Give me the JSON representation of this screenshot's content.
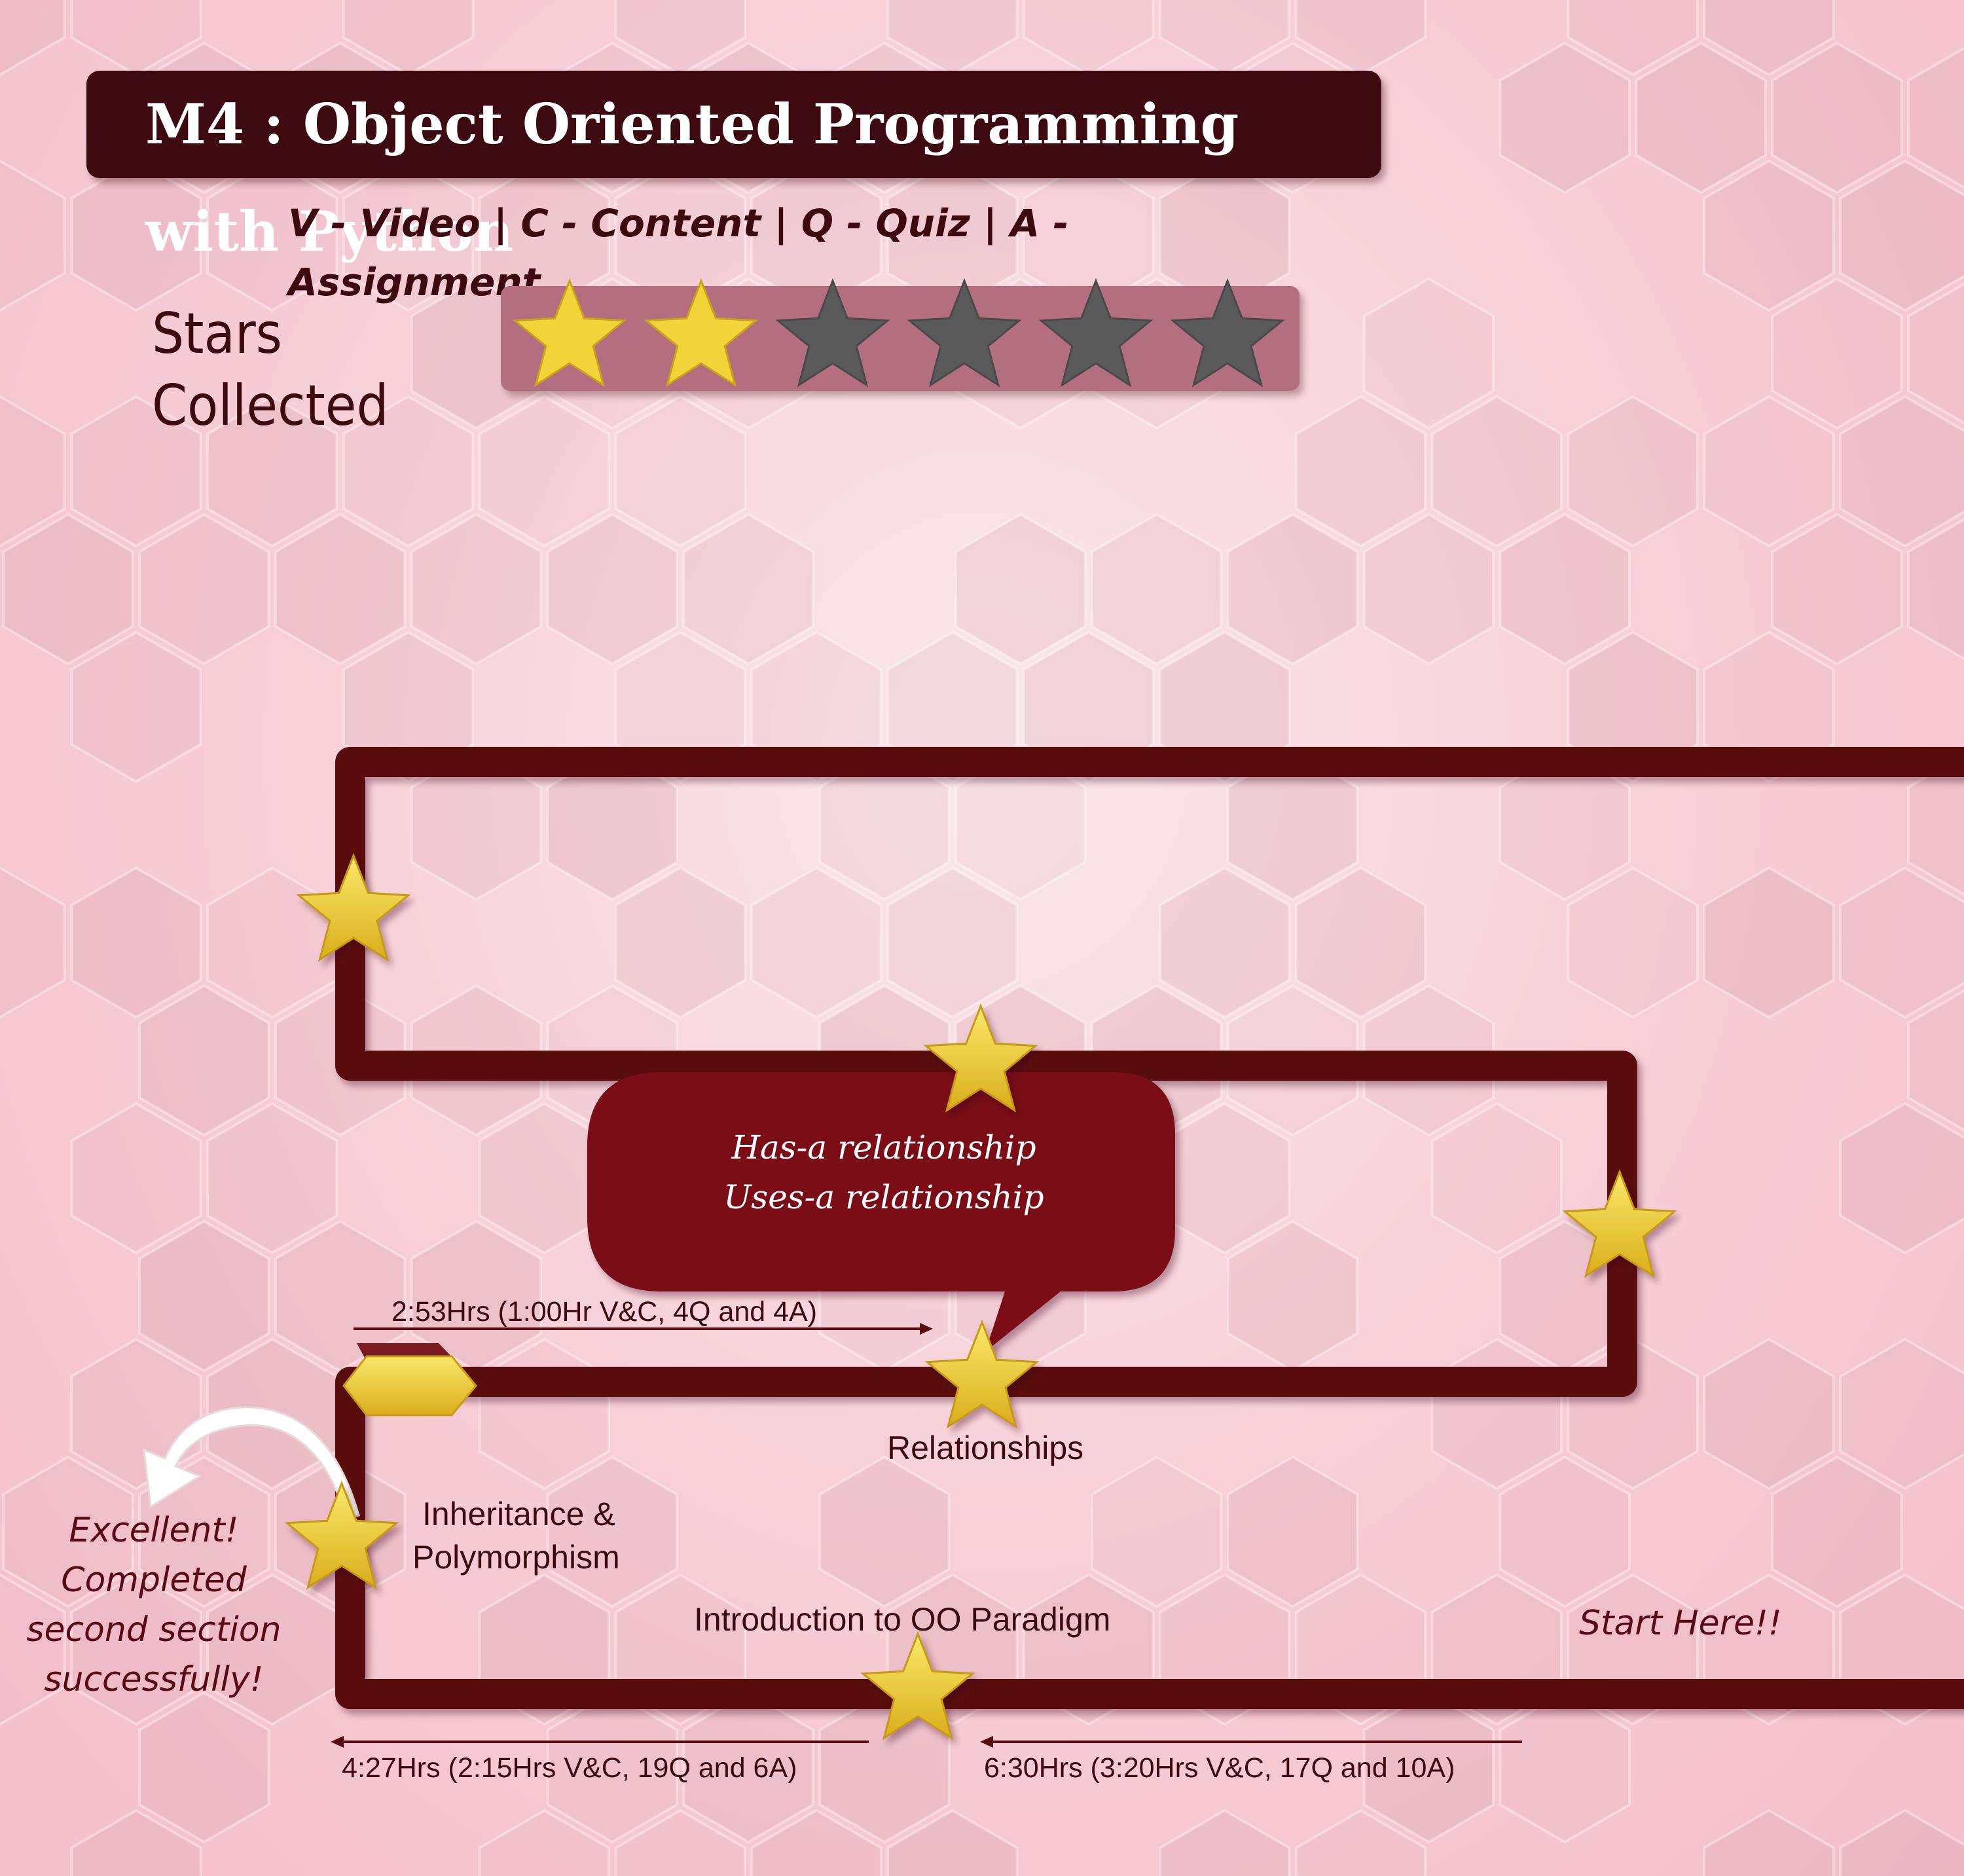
{
  "header": {
    "title": "M4 : Object Oriented Programming with Python",
    "legend": "V - Video | C - Content | Q - Quiz | A - Assignment"
  },
  "stars": {
    "label": "Stars Collected",
    "collected": 2,
    "total": 6,
    "gold_color": "#f2d43a",
    "empty_color": "#5a5a5a"
  },
  "path": {
    "color": "#5a0a10",
    "bubble": {
      "line1": "Has-a relationship",
      "line2": "Uses-a relationship",
      "color": "#7a0a12"
    },
    "sections": [
      {
        "name": "Introduction to OO Paradigm",
        "duration": "6:30Hrs (3:20Hrs V&C, 17Q and 10A)"
      },
      {
        "name_line1": "Inheritance &",
        "name_line2": "Polymorphism",
        "duration": "4:27Hrs (2:15Hrs V&C, 19Q and 6A)"
      },
      {
        "name": "Relationships",
        "duration": "2:53Hrs (1:00Hr V&C, 4Q and 4A)"
      }
    ],
    "start_label": "Start Here!!",
    "completion_note": [
      "Excellent!",
      "Completed",
      "second section",
      "successfully!"
    ]
  }
}
